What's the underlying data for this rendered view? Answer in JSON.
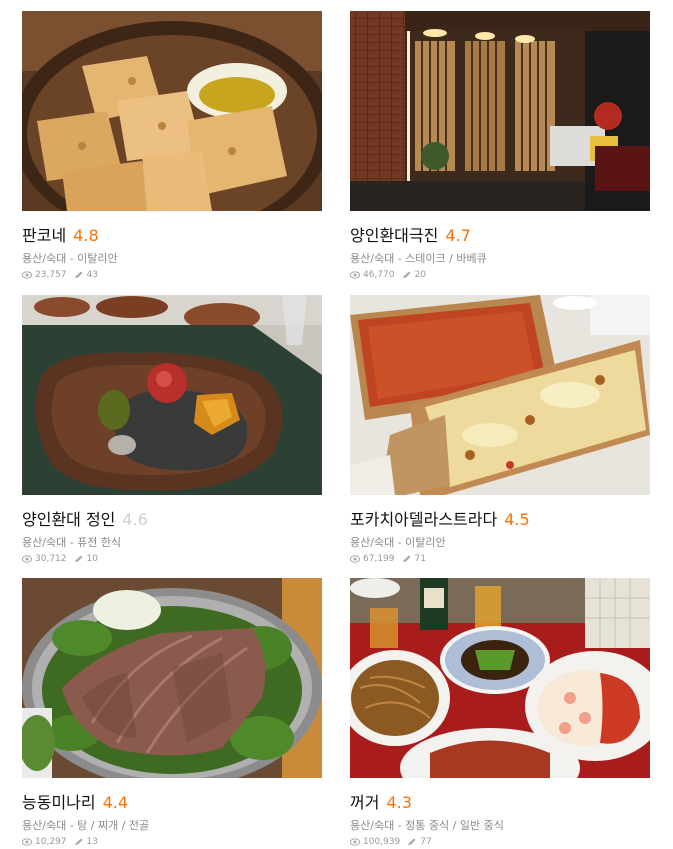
{
  "restaurants": [
    {
      "name": "판코네",
      "rating": "4.8",
      "area": "용산/숙대",
      "category": "이탈리안",
      "views": "23,757",
      "reviews": "43",
      "rating_style": "accent"
    },
    {
      "name": "양인환대극진",
      "rating": "4.7",
      "area": "용산/숙대",
      "category": "스테이크 / 바베큐",
      "views": "46,770",
      "reviews": "20",
      "rating_style": "accent"
    },
    {
      "name": "양인환대 정인",
      "rating": "4.6",
      "area": "용산/숙대",
      "category": "퓨전 한식",
      "views": "30,712",
      "reviews": "10",
      "rating_style": "muted"
    },
    {
      "name": "포카치아델라스트라다",
      "rating": "4.5",
      "area": "용산/숙대",
      "category": "이탈리안",
      "views": "67,199",
      "reviews": "71",
      "rating_style": "accent"
    },
    {
      "name": "능동미나리",
      "rating": "4.4",
      "area": "용산/숙대",
      "category": "탕 / 찌개 / 전골",
      "views": "10,297",
      "reviews": "13",
      "rating_style": "accent"
    },
    {
      "name": "꺼거",
      "rating": "4.3",
      "area": "용산/숙대",
      "category": "정통 중식 / 일반 중식",
      "views": "100,939",
      "reviews": "77",
      "rating_style": "accent"
    }
  ],
  "meta_separator": " - ",
  "colors": {
    "accent": "#ff7100",
    "muted_rating": "#cfcfcf",
    "meta_text": "#8a8a8a"
  },
  "icons": {
    "views": "eye-icon",
    "reviews": "pencil-icon"
  }
}
